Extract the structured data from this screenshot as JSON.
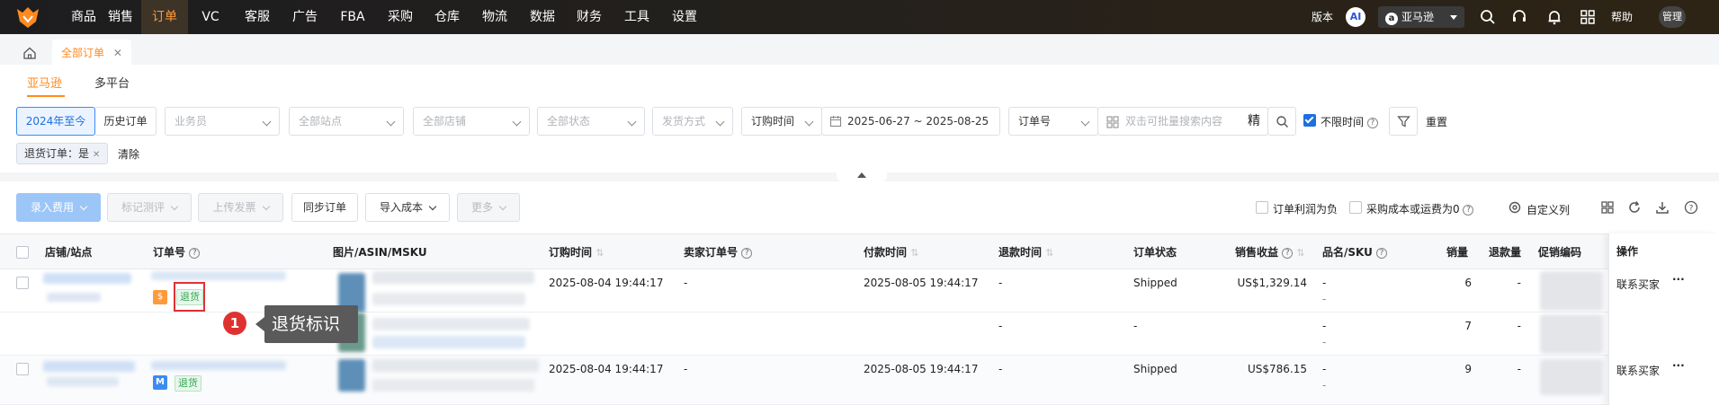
{
  "nav": {
    "items": [
      "商品",
      "销售",
      "订单",
      "VC",
      "客服",
      "广告",
      "FBA",
      "采购",
      "仓库",
      "物流",
      "数据",
      "财务",
      "工具",
      "设置"
    ],
    "active_index": 2,
    "version_label": "版本",
    "ai_label": "AI",
    "marketplace": "亚马逊",
    "help_label": "帮助",
    "user_label": "管理"
  },
  "tabs": {
    "page_tab": "全部订单"
  },
  "subtabs": [
    "亚马逊",
    "多平台"
  ],
  "filters": {
    "year_range": "2024年至今",
    "history": "历史订单",
    "salesperson": "业务员",
    "site": "全部站点",
    "shop": "全部店铺",
    "status": "全部状态",
    "ship_method": "发货方式",
    "time_type": "订购时间",
    "date_range": "2025-06-27 ~ 2025-08-25",
    "search_type": "订单号",
    "search_placeholder": "双击可批量搜索内容",
    "exact_label": "精",
    "unlimited_time": "不限时间",
    "reset": "重置",
    "active_tag": "退货订单：是",
    "clear": "清除"
  },
  "actions": {
    "import_fees": "录入费用",
    "mark_review": "标记测评",
    "upload_invoice": "上传发票",
    "sync_orders": "同步订单",
    "import_cost": "导入成本",
    "more": "更多",
    "profit_negative": "订单利润为负",
    "cost_zero": "采购成本或运费为0",
    "custom_columns": "自定义列"
  },
  "table": {
    "headers": {
      "shop": "店铺/站点",
      "order_no": "订单号",
      "image_asin": "图片/ASIN/MSKU",
      "order_time": "订购时间",
      "seller_order": "卖家订单号",
      "pay_time": "付款时间",
      "refund_time": "退款时间",
      "status": "订单状态",
      "revenue": "销售收益",
      "product_sku": "品名/SKU",
      "qty": "销量",
      "refund_qty": "退款量",
      "promo": "促销编码",
      "ops": "操作"
    },
    "rows": [
      {
        "ret_tag": "退货",
        "order_time": "2025-08-04 19:44:17",
        "seller_order": "-",
        "pay_time": "2025-08-05 19:44:17",
        "refund_time": "-",
        "status": "Shipped",
        "revenue": "US$1,329.14",
        "sku": "-",
        "sku2": "-",
        "qty": "6",
        "refund_qty": "-",
        "op_contact": "联系买家",
        "op_more": "···"
      },
      {
        "ret_tag": "",
        "order_time": "",
        "seller_order": "",
        "pay_time": "",
        "refund_time": "-",
        "status": "-",
        "revenue": "",
        "sku": "-",
        "sku2": "-",
        "qty": "7",
        "refund_qty": "-",
        "op_contact": "",
        "op_more": ""
      },
      {
        "ret_tag": "退货",
        "order_time": "2025-08-04 19:44:17",
        "seller_order": "-",
        "pay_time": "2025-08-05 19:44:17",
        "refund_time": "-",
        "status": "Shipped",
        "revenue": "US$786.15",
        "sku": "-",
        "sku2": "-",
        "qty": "9",
        "refund_qty": "-",
        "op_contact": "联系买家",
        "op_more": "···"
      }
    ]
  },
  "annotation": {
    "number": "1",
    "text": "退货标识"
  },
  "colors": {
    "accent": "#ff8a1f",
    "link": "#1e6fe0",
    "return_tag": "#2fa84f",
    "callout_red": "#e03131"
  }
}
